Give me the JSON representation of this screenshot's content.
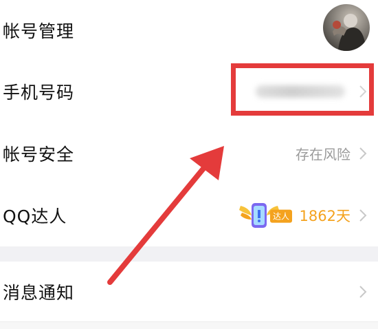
{
  "settings": {
    "account_management": {
      "label": "帐号管理"
    },
    "phone_number": {
      "label": "手机号码"
    },
    "account_security": {
      "label": "帐号安全",
      "status": "存在风险"
    },
    "qq_expert": {
      "label": "QQ达人",
      "badge_text": "达人",
      "days": "1862天"
    },
    "notifications": {
      "label": "消息通知"
    }
  },
  "colors": {
    "highlight": "#e43b3b",
    "accent_gold": "#f4a21e",
    "secondary_text": "#9a9a9a",
    "section_gap": "#f1f1f4"
  },
  "icons": {
    "chevron": "chevron-right-icon",
    "badge": "qq-expert-badge-icon"
  }
}
